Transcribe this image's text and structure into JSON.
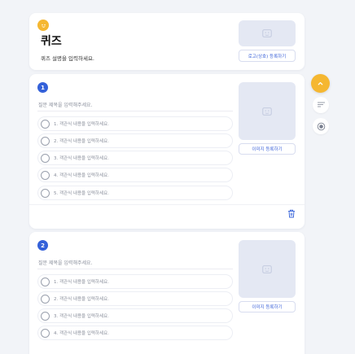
{
  "header": {
    "title": "퀴즈",
    "description": "퀴즈 설명을 입력하세요.",
    "logo_button_label": "로고(상호) 등록하기",
    "badge_icon": "smile-icon",
    "badge_color": "#f5b731"
  },
  "questions": [
    {
      "number": "1",
      "title_placeholder": "질문 제목을 입력해주세요.",
      "options": [
        "1. 객관식 내용을 입력하세요.",
        "2. 객관식 내용을 입력하세요.",
        "3. 객관식 내용을 입력하세요.",
        "4. 객관식 내용을 입력하세요.",
        "5. 객관식 내용을 입력하세요."
      ],
      "image_button_label": "이미지 등록하기"
    },
    {
      "number": "2",
      "title_placeholder": "질문 제목을 입력해주세요.",
      "options": [
        "1. 객관식 내용을 입력하세요.",
        "2. 객관식 내용을 입력하세요.",
        "3. 객관식 내용을 입력하세요.",
        "4. 객관식 내용을 입력하세요."
      ],
      "image_button_label": "이미지 등록하기"
    }
  ],
  "sidebar": {
    "scroll_top_icon": "chevron-up-icon",
    "text_question_icon": "short-text-icon",
    "choice_question_icon": "radio-icon"
  },
  "colors": {
    "accent": "#3461d9",
    "yellow": "#f5b731",
    "background": "#f2f4f8"
  }
}
